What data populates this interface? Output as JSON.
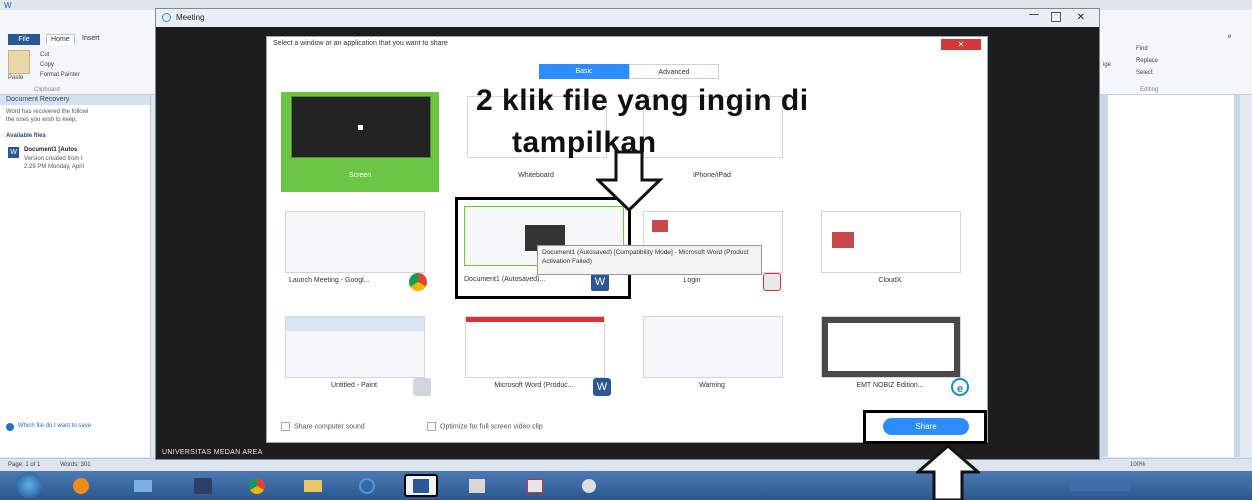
{
  "word": {
    "qat_label": "W",
    "tabs": [
      "File",
      "Home",
      "Insert"
    ],
    "ribbon": {
      "paste": "Paste",
      "cut": "Cut",
      "copy": "Copy",
      "format_painter": "Format Painter",
      "clipboard": "Clipboard",
      "find": "Find",
      "replace": "Replace",
      "select": "Select",
      "editing": "Editing",
      "fragment_left": "ige",
      "fragment_right": "e"
    },
    "recovery": {
      "header": "Document Recovery",
      "desc_1": "Word has recovered the followi",
      "desc_2": "the ones you wish to keep.",
      "available": "Available files",
      "doc_name": "Document1 [Autos",
      "doc_line2": "Version created from t",
      "doc_line3": "2:29 PM Monday, April",
      "help": "Which file do I want to save"
    },
    "status": {
      "page": "Page: 1 of 1",
      "words": "Words: 301",
      "zoom": "100%"
    }
  },
  "meeting": {
    "title": "Meeting",
    "footer": "UNIVERSITAS MEDAN AREA"
  },
  "dialog": {
    "title": "Select a window or an application that you want to share",
    "tab_basic": "Basic",
    "tab_advanced": "Advanced",
    "tiles": [
      {
        "label": "Screen"
      },
      {
        "label": "Whiteboard"
      },
      {
        "label": "iPhone/iPad"
      },
      {
        "label": "Launch Meeting - Googl..."
      },
      {
        "label": "Document1 (Autosaved)..."
      },
      {
        "label": "Login"
      },
      {
        "label": "CloudX"
      },
      {
        "label": "Untitled - Paint"
      },
      {
        "label": "Microsoft Word (Produc..."
      },
      {
        "label": "Warning"
      },
      {
        "label": "EMT NOBIZ Edition..."
      }
    ],
    "tooltip": "Document1 (Autosaved) [Compatibility Mode] - Microsoft Word (Product Activation Failed)",
    "share_sound": "Share computer sound",
    "optimize": "Optimize for full screen video clip",
    "share_button": "Share"
  },
  "annotation": {
    "line1": "2 klik file yang ingin di",
    "line2": "tampilkan"
  },
  "icons": [
    "chrome-icon",
    "word-icon",
    "paint-icon",
    "ie-icon",
    "login-icon"
  ]
}
